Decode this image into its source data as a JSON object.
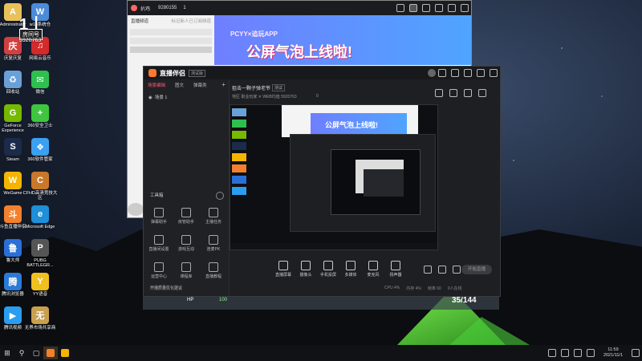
{
  "desktop": {
    "icons": [
      {
        "label": "Administrator",
        "glyph": "A",
        "color": "#e8c15a"
      },
      {
        "label": "w10系统仓",
        "glyph": "W",
        "color": "#4c8bd8"
      },
      {
        "label": "庆复庆复",
        "glyph": "庆",
        "color": "#d04040"
      },
      {
        "label": "网易云音乐",
        "glyph": "♫",
        "color": "#d42a2a"
      },
      {
        "label": "回收站",
        "glyph": "♻",
        "color": "#6aa0d8"
      },
      {
        "label": "微信",
        "glyph": "✉",
        "color": "#2fbf4f"
      },
      {
        "label": "GeForce Experience",
        "glyph": "G",
        "color": "#76b900"
      },
      {
        "label": "360安全卫士",
        "glyph": "+",
        "color": "#3ec63e"
      },
      {
        "label": "Steam",
        "glyph": "S",
        "color": "#1b2b4a"
      },
      {
        "label": "360软件管家",
        "glyph": "❖",
        "color": "#3ba0f0"
      },
      {
        "label": "WeGame",
        "glyph": "W",
        "color": "#f4b400"
      },
      {
        "label": "CFHD高清竞技大区",
        "glyph": "C",
        "color": "#c9782a"
      },
      {
        "label": "斗鱼直播伴侣",
        "glyph": "斗",
        "color": "#f2802c"
      },
      {
        "label": "Microsoft Edge",
        "glyph": "e",
        "color": "#1e8fd8"
      },
      {
        "label": "鲁大师",
        "glyph": "鲁",
        "color": "#2a6fd8"
      },
      {
        "label": "PUBG BATTLEGR...",
        "glyph": "P",
        "color": "#555"
      },
      {
        "label": "腾讯浏览器",
        "glyph": "腾",
        "color": "#2a7ad8"
      },
      {
        "label": "YY语音",
        "glyph": "Y",
        "color": "#f0c020"
      },
      {
        "label": "腾讯视频",
        "glyph": "▶",
        "color": "#2a9df0"
      },
      {
        "label": "无界市场共享商",
        "glyph": "无",
        "color": "#c8a050"
      }
    ]
  },
  "qq_window": {
    "title": "扒鸡",
    "id": "9280155",
    "members": "1",
    "banner_top": "PCYY×追玩APP",
    "banner_main": "公屏气泡上线啦!",
    "sidebar_title": "直播频道",
    "sidebar_hint": "标记新人已订阅频道"
  },
  "app": {
    "logo": "直播伴侣",
    "badge": "测试版",
    "tabs": [
      "场景编辑",
      "图文",
      "弹幕类"
    ],
    "scene_item": "场景 1",
    "room_title": "狙击一颗子弹老爷",
    "room_tag": "测试",
    "room_info": "地区  职业玩家  ✕  WEB均值  5920763",
    "room_count": "0",
    "tools_title": "工具箱",
    "tools": [
      {
        "label": "弹幕助手"
      },
      {
        "label": "房管助手"
      },
      {
        "label": "主播任务"
      },
      {
        "label": "直播间设置"
      },
      {
        "label": "游戏互动"
      },
      {
        "label": "连麦PK"
      },
      {
        "label": "运营中心"
      },
      {
        "label": "课程库"
      },
      {
        "label": "直播教程"
      }
    ],
    "bottom_note": "开播质量优化建议",
    "controls": [
      {
        "label": "直播屏幕"
      },
      {
        "label": "摄像头"
      },
      {
        "label": "手机投屏"
      },
      {
        "label": "多媒体"
      },
      {
        "label": "麦克风"
      },
      {
        "label": "扬声器"
      }
    ],
    "start_button": "开始直播",
    "stats": [
      "CPU 4%",
      "内存 4%",
      "帧率 60",
      "0人在线"
    ]
  },
  "overlay": {
    "watermark": "1丨",
    "room_label": "房间号",
    "room_number": "5920763",
    "hp_label": "HP",
    "hp_value": "100",
    "ammo": "35/144"
  },
  "taskbar": {
    "search_icon": "search-icon",
    "pinned": [
      "斗鱼",
      "快手"
    ],
    "time": "11:59",
    "date": "2021/11/1"
  }
}
